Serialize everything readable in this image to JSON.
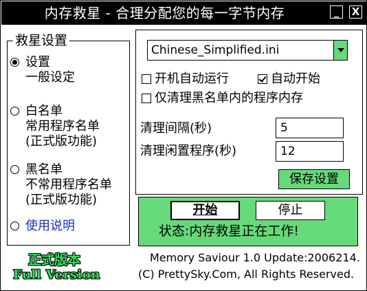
{
  "window": {
    "title": "内存救星 - 合理分配您的每一字节内存",
    "minimize_label": "_",
    "close_label": "X"
  },
  "left_group": {
    "title": "救星设置",
    "options": [
      {
        "line1": "设置",
        "line2": "一般设定",
        "line3": "",
        "selected": true
      },
      {
        "line1": "白名单",
        "line2": "常用程序名单",
        "line3": "(正式版功能)",
        "selected": false
      },
      {
        "line1": "黑名单",
        "line2": "不常用程序名单",
        "line3": "(正式版功能)",
        "selected": false
      },
      {
        "line1": "使用说明",
        "line2": "",
        "line3": "",
        "selected": false
      }
    ]
  },
  "settings": {
    "language_file": "Chinese_Simplified.ini",
    "autorun_label": "开机自动运行",
    "autorun_checked": false,
    "autostart_label": "自动开始",
    "autostart_checked": true,
    "blacklist_only_label": "仅清理黑名单内的程序内存",
    "blacklist_only_checked": false,
    "interval_label": "清理间隔(秒)",
    "interval_value": "5",
    "idle_label": "清理闲置程序(秒)",
    "idle_value": "12",
    "save_label": "保存设置"
  },
  "control": {
    "start_label": "开始",
    "stop_label": "停止",
    "status_text": "状态:内存救星正在工作!"
  },
  "footer": {
    "badge_cn": "正式版本",
    "badge_en": "Full Version",
    "version_text": "Memory Saviour 1.0 Update:2006214.",
    "copyright_text": "(C) PrettySky.Com, All Rights Reserved."
  },
  "colors": {
    "accent_green": "#66d97a",
    "badge_green": "#2fe25a",
    "link_blue": "#1a2fc0"
  }
}
